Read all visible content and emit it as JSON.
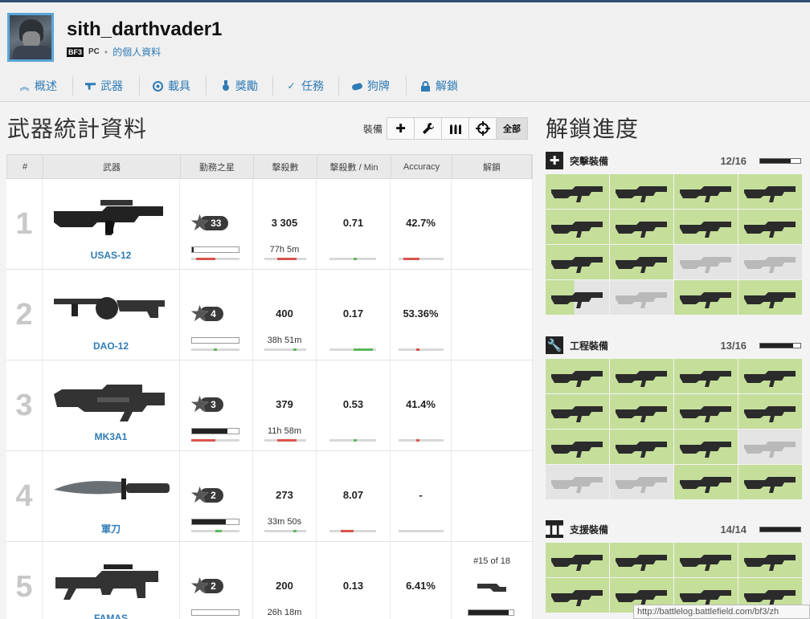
{
  "profile": {
    "username": "sith_darthvader1",
    "game_badge": "BF3",
    "platform": "PC",
    "dot": "•",
    "profile_link": "的個人資料"
  },
  "nav": [
    {
      "label": "概述",
      "icon": "chevron-up-icon"
    },
    {
      "label": "武器",
      "icon": "pistol-icon"
    },
    {
      "label": "載具",
      "icon": "wheel-icon"
    },
    {
      "label": "獎勵",
      "icon": "medal-icon"
    },
    {
      "label": "任務",
      "icon": "check-icon"
    },
    {
      "label": "狗牌",
      "icon": "dogtag-icon"
    },
    {
      "label": "解鎖",
      "icon": "lock-icon"
    }
  ],
  "weapons_title": "武器統計資料",
  "filter": {
    "label": "裝備",
    "buttons": [
      {
        "glyph": "✚",
        "icon": "assault-plus-icon"
      },
      {
        "glyph": "🔧",
        "icon": "wrench-icon"
      },
      {
        "glyph": "▮▮▮",
        "icon": "ammo-icon"
      },
      {
        "glyph": "⌖",
        "icon": "crosshair-icon"
      },
      {
        "glyph": "全部",
        "icon": "all"
      }
    ]
  },
  "table": {
    "headers": [
      "#",
      "武器",
      "勤務之星",
      "擊殺數",
      "擊殺數 / Min",
      "Accuracy",
      "解鎖"
    ],
    "rows": [
      {
        "rank": "1",
        "name": "USAS-12",
        "stars": "33",
        "star_progress": 0.03,
        "kills": "3 305",
        "time": "77h 5m",
        "kpm": "0.71",
        "accuracy": "42.7%",
        "unlock": ""
      },
      {
        "rank": "2",
        "name": "DAO-12",
        "stars": "4",
        "star_progress": 0.0,
        "kills": "400",
        "time": "38h 51m",
        "kpm": "0.17",
        "accuracy": "53.36%",
        "unlock": ""
      },
      {
        "rank": "3",
        "name": "MK3A1",
        "stars": "3",
        "star_progress": 0.75,
        "kills": "379",
        "time": "11h 58m",
        "kpm": "0.53",
        "accuracy": "41.4%",
        "unlock": ""
      },
      {
        "rank": "4",
        "name": "軍刀",
        "stars": "2",
        "star_progress": 0.72,
        "kills": "273",
        "time": "33m 50s",
        "kpm": "8.07",
        "accuracy": "-",
        "unlock": ""
      },
      {
        "rank": "5",
        "name": "FAMAS",
        "stars": "2",
        "star_progress": 0.0,
        "kills": "200",
        "time": "26h 18m",
        "kpm": "0.13",
        "accuracy": "6.41%",
        "unlock": "#15 of 18"
      }
    ]
  },
  "unlock_title": "解鎖進度",
  "categories": [
    {
      "name": "突擊裝備",
      "count": "12/16",
      "fraction": 0.75,
      "icon": "plus-icon",
      "glyph": "✚",
      "tiles": [
        1,
        1,
        1,
        1,
        1,
        1,
        1,
        1,
        1,
        1,
        0,
        0,
        0.5,
        0,
        1,
        1
      ]
    },
    {
      "name": "工程裝備",
      "count": "13/16",
      "fraction": 0.81,
      "icon": "wrench-icon",
      "glyph": "🔧",
      "tiles": [
        1,
        1,
        1,
        1,
        1,
        1,
        1,
        1,
        1,
        1,
        1,
        0,
        0,
        0,
        1,
        1
      ]
    },
    {
      "name": "支援裝備",
      "count": "14/14",
      "fraction": 1.0,
      "icon": "ammo-icon",
      "glyph": "▮▮▮",
      "tiles": [
        1,
        1,
        1,
        1,
        1,
        1,
        1,
        1
      ]
    }
  ],
  "status_url": "http://battlelog.battlefield.com/bf3/zh"
}
